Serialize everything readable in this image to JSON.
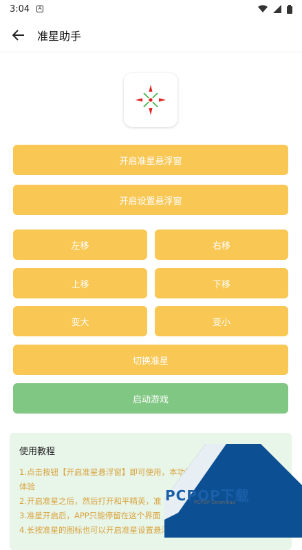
{
  "status_bar": {
    "time": "3:04",
    "notif_icon": "A"
  },
  "app_bar": {
    "title": "准星助手"
  },
  "buttons": {
    "open_crosshair": "开启准星悬浮窗",
    "open_settings": "开启设置悬浮窗",
    "left": "左移",
    "right": "右移",
    "up": "上移",
    "down": "下移",
    "bigger": "变大",
    "smaller": "变小",
    "switch": "切换准星",
    "start_game": "启动游戏"
  },
  "tutorial": {
    "title": "使用教程",
    "lines": [
      "1.点击按钮【开启准星悬浮窗】即可使用，本功能提供",
      "体验",
      "2.开启准星之后，然后打开和平精英，准",
      "3.准星开启后，APP只能停留在这个界面",
      "4.长按准星的图标也可以开启准星设置悬浮窗"
    ]
  },
  "watermark": {
    "text": "PCPOP下载",
    "sub": "PCPOP Download"
  },
  "colors": {
    "accent": "#f8c754",
    "green": "#80c783",
    "tutorial_bg": "#e8f5e9",
    "tutorial_text": "#d8a23a",
    "crosshair_red": "#e02020",
    "crosshair_green": "#3cb043"
  }
}
